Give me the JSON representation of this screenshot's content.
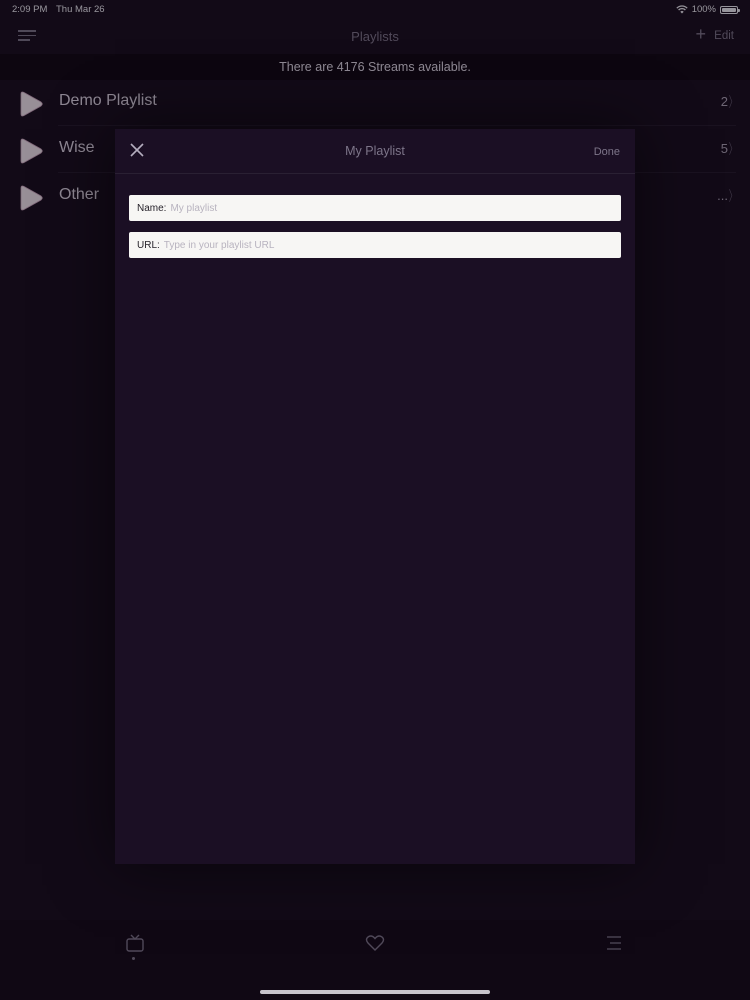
{
  "status_bar": {
    "time": "2:09 PM",
    "date": "Thu Mar 26",
    "battery": "100%",
    "icons": [
      "wifi-icon",
      "battery-icon"
    ]
  },
  "nav": {
    "title": "Playlists",
    "add_icon": "plus-icon",
    "edit_label": "Edit",
    "menu_icon": "menu-icon"
  },
  "banner": {
    "text": "There are 4176 Streams available."
  },
  "playlists": [
    {
      "name": "Demo Playlist",
      "count": "2"
    },
    {
      "name": "Wise",
      "count": "5"
    },
    {
      "name": "Other",
      "count": "..."
    }
  ],
  "modal": {
    "title": "My Playlist",
    "close_icon": "close-icon",
    "done_label": "Done",
    "name_field": {
      "label": "Name:",
      "value": "",
      "placeholder": "My playlist"
    },
    "url_field": {
      "label": "URL:",
      "value": "",
      "placeholder": "Type in your playlist URL"
    }
  },
  "tab_bar": {
    "tabs": [
      {
        "icon": "tv-icon",
        "selected": true
      },
      {
        "icon": "heart-icon",
        "selected": false
      },
      {
        "icon": "list-icon",
        "selected": false
      }
    ]
  },
  "colors": {
    "background": "#180d1e",
    "modal": "#1b0f24",
    "accent_play": "#f2e6ef",
    "muted_text": "#7d7589"
  }
}
